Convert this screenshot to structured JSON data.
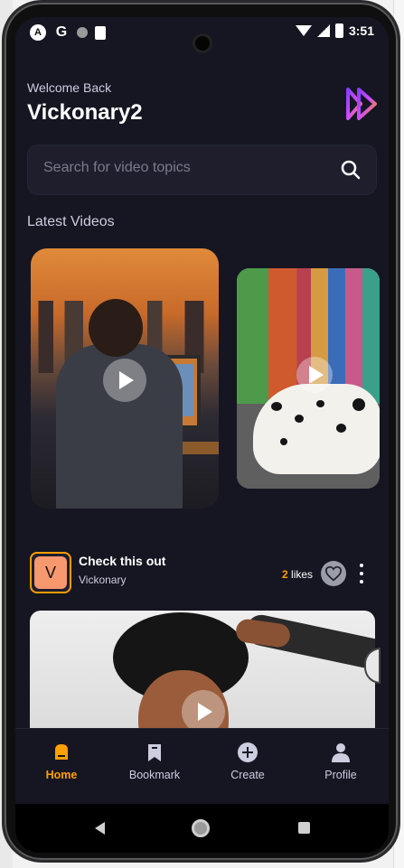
{
  "header": {
    "welcome_text": "Welcome Back",
    "username": "Vickonary2"
  },
  "status_bar": {
    "time": "3:51",
    "icons": [
      "a-icon",
      "google-icon",
      "dot-icon",
      "sd-card-icon",
      "wifi-icon",
      "signal-icon",
      "battery-icon"
    ]
  },
  "search": {
    "placeholder": "Search for video topics"
  },
  "latest_videos": {
    "title": "Latest Videos"
  },
  "post": {
    "avatar_letter": "V",
    "title": "Check this out",
    "author": "Vickonary",
    "likes_count": "2",
    "likes_label": " likes"
  },
  "tabs": [
    {
      "label": "Home",
      "icon": "home-icon",
      "active": true
    },
    {
      "label": "Bookmark",
      "icon": "bookmark-icon",
      "active": false
    },
    {
      "label": "Create",
      "icon": "plus-circle-icon",
      "active": false
    },
    {
      "label": "Profile",
      "icon": "profile-icon",
      "active": false
    }
  ],
  "colors": {
    "background": "#161622",
    "accent": "#FF9C01",
    "card": "#1E1E2D",
    "muted_text": "#CDCDE0"
  }
}
